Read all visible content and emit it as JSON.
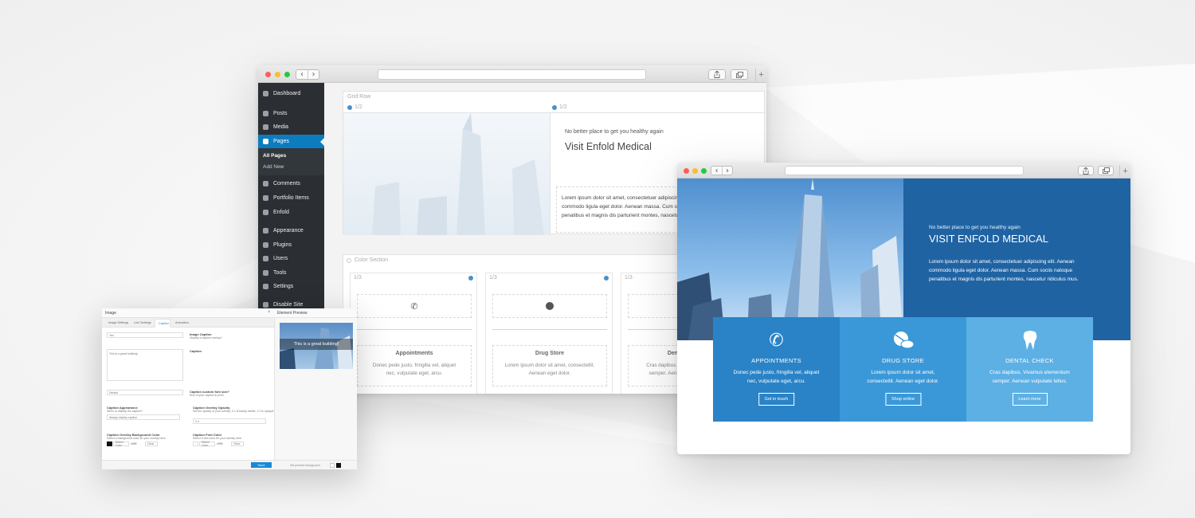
{
  "builder_window": {
    "sidebar": {
      "items": [
        {
          "label": "Dashboard",
          "icon": "dashboard-icon"
        },
        {
          "label": "Posts",
          "icon": "pin-icon"
        },
        {
          "label": "Media",
          "icon": "media-icon"
        },
        {
          "label": "Pages",
          "icon": "pages-icon",
          "active": true
        },
        {
          "label": "Comments",
          "icon": "comment-icon"
        },
        {
          "label": "Portfolio Items",
          "icon": "portfolio-icon"
        },
        {
          "label": "Enfold",
          "icon": "enfold-icon"
        },
        {
          "label": "Appearance",
          "icon": "brush-icon"
        },
        {
          "label": "Plugins",
          "icon": "plugin-icon"
        },
        {
          "label": "Users",
          "icon": "user-icon"
        },
        {
          "label": "Tools",
          "icon": "wrench-icon"
        },
        {
          "label": "Settings",
          "icon": "settings-icon"
        },
        {
          "label": "Disable Site",
          "icon": "gear-icon"
        }
      ],
      "submenu": [
        "All Pages",
        "Add New"
      ]
    },
    "grid_row": {
      "label": "Grid Row",
      "col1": "1/2",
      "col2": "1/2",
      "tagline": "No better place to get you healthy again",
      "heading": "Visit Enfold Medical",
      "body": [
        "Lorem ipsum dolor sit amet, consectetuer adipiscing elit. Aenean",
        "commodo ligula eget dolor. Aenean massa. Cum sociis natoque",
        "penatibus et magnis dis parturient montes, nascetur ridiculus mus."
      ]
    },
    "color_section": {
      "label": "Color Section",
      "columns": [
        {
          "size": "1/3",
          "title": "Appointments",
          "icon": "phone-icon",
          "text": [
            "Donec pede justo, fringilla vel, aliquet",
            "nec, vulputate eget, arcu."
          ]
        },
        {
          "size": "1/3",
          "title": "Drug Store",
          "icon": "pills-icon",
          "text": [
            "Lorem ipsum dolor sit amet, consectetlit.",
            "Aenean eget dolor."
          ]
        },
        {
          "size": "1/3",
          "title": "Dental Check",
          "icon": "tooth-icon",
          "text": [
            "Cras dapibus. Vivamus elementum",
            "semper. Aenean vulputate tellus."
          ]
        }
      ]
    }
  },
  "frontend_window": {
    "hero": {
      "tagline": "No better place to get you healthy again",
      "heading": "VISIT ENFOLD MEDICAL",
      "body": [
        "Lorem ipsum dolor sit amet, consectetuer adipiscing elit. Aenean",
        "commodo ligula eget dolor. Aenean massa. Cum sociis natoque",
        "penatibus et magnis dis parturient montes, nascetur ridiculus mus."
      ]
    },
    "services": [
      {
        "title": "APPOINTMENTS",
        "icon": "phone-icon",
        "text": [
          "Donec pede justo, fringilla vel, aliquet",
          "nec, vulputate eget, arcu."
        ],
        "button": "Get in touch",
        "color": "#2a83c6"
      },
      {
        "title": "DRUG STORE",
        "icon": "pills-icon",
        "text": [
          "Lorem ipsum dolor sit amet,",
          "consectetlit. Aenean eget dolor."
        ],
        "button": "Shop online",
        "color": "#3b98d8"
      },
      {
        "title": "DENTAL CHECK",
        "icon": "tooth-icon",
        "text": [
          "Cras dapibus. Vivamus elementum",
          "semper. Aenean vulputate tellus."
        ],
        "button": "Learn more",
        "color": "#5db0e4"
      }
    ],
    "colors": {
      "hero_blue": "#1f63a3"
    }
  },
  "image_dialog": {
    "title": "Image",
    "preview_title": "Element Preview",
    "tabs": [
      "Image Settings",
      "Link Settings",
      "Caption",
      "Animation"
    ],
    "active_tab": "Caption",
    "caption_select": "Yes",
    "caption_textarea": "This is a great building!",
    "caption_size_select": "Default",
    "preview_caption": "This is a great building!",
    "fields": {
      "image_caption_label": "Image Caption",
      "image_caption_sub": "Display a caption overlay?",
      "caption_label": "Caption",
      "font_size_label": "Caption custom font size?",
      "font_size_sub": "Size of your caption in pixel",
      "appearance_label": "Caption Appearance",
      "appearance_sub": "When to display the caption?",
      "appearance_value": "Always display caption",
      "opacity_label": "Caption Overlay Opacity",
      "opacity_sub": "Set the opacity of your overlay: 0.1 is barely visible, 1.0 is opaque",
      "opacity_value": "0.4",
      "bg_color_label": "Caption Overlay Background Color",
      "bg_color_sub": "Select a background color for your overlay here.",
      "font_color_label": "Caption Font Color",
      "font_color_sub": "Select a font color for your overlay here.",
      "select_color": "Select Color",
      "clear": "Clear",
      "default_hex": "#ffffff"
    },
    "save": "Save",
    "preview_bg_label": "Set preview background"
  }
}
